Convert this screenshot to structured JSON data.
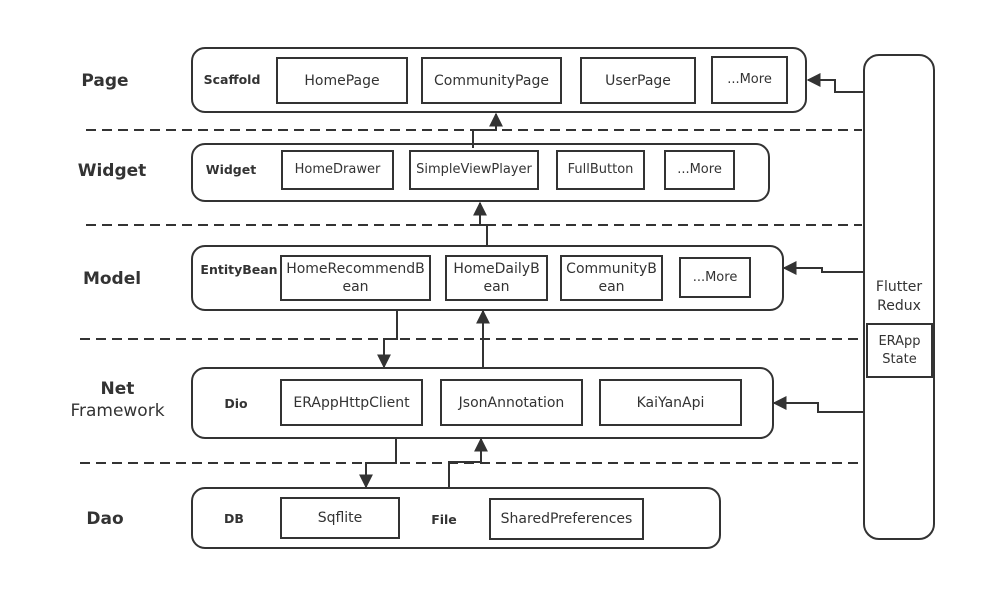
{
  "layers": [
    {
      "label": "Page",
      "group_label": "Scaffold",
      "components": [
        "HomePage",
        "CommunityPage",
        "UserPage",
        "...More"
      ]
    },
    {
      "label": "Widget",
      "group_label": "Widget",
      "components": [
        "HomeDrawer",
        "SimpleViewPlayer",
        "FullButton",
        "...More"
      ]
    },
    {
      "label": "Model",
      "group_label": "EntityBean",
      "components": [
        "HomeRecommendBean",
        "HomeDailyBean",
        "CommunityBean",
        "...More"
      ]
    },
    {
      "label": "Net",
      "label_sub": "Framework",
      "group_label": "Dio",
      "components": [
        "ERAppHttpClient",
        "JsonAnnotation",
        "KaiYanApi"
      ]
    },
    {
      "label": "Dao",
      "group_label": "DB",
      "group_label_2": "File",
      "components": [
        "Sqflite",
        "SharedPreferences"
      ]
    }
  ],
  "redux": {
    "label_line1": "Flutter",
    "label_line2": "Redux",
    "state_label_line1": "ERApp",
    "state_label_line2": "State"
  },
  "connections": [
    {
      "from": "Widget.SimpleViewPlayer",
      "to": "Page.CommunityPage",
      "direction": "up"
    },
    {
      "from": "Model.HomeDailyBean",
      "to": "Widget.SimpleViewPlayer",
      "direction": "up"
    },
    {
      "from": "Model",
      "to": "Net",
      "direction": "down"
    },
    {
      "from": "Net",
      "to": "Model",
      "direction": "up"
    },
    {
      "from": "Net",
      "to": "Dao.Sqflite",
      "direction": "down"
    },
    {
      "from": "Dao",
      "to": "Net.JsonAnnotation",
      "direction": "up"
    },
    {
      "from": "Redux",
      "to": "Page",
      "direction": "left"
    },
    {
      "from": "Redux",
      "to": "Model",
      "direction": "left"
    },
    {
      "from": "Redux",
      "to": "Net",
      "direction": "left"
    }
  ]
}
